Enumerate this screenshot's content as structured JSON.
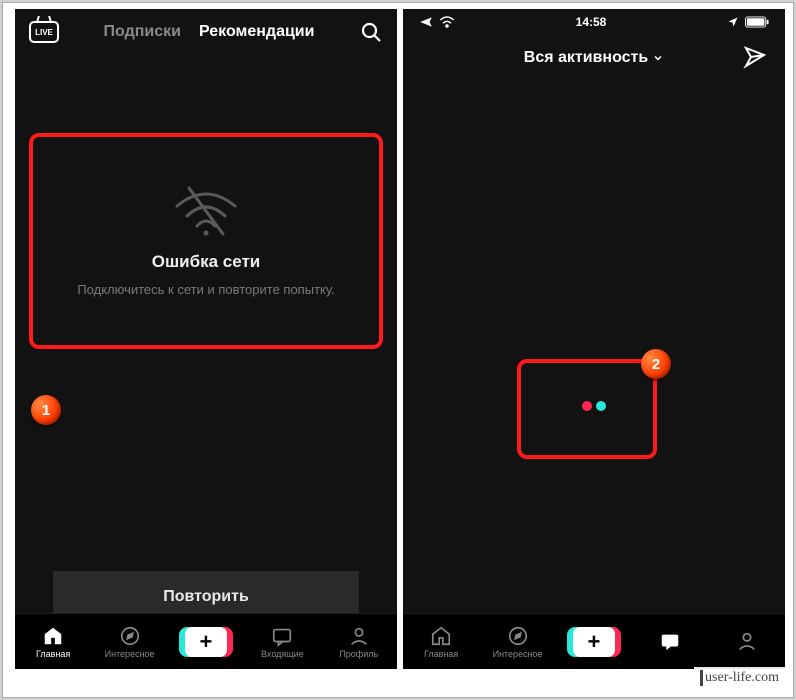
{
  "left": {
    "tabs": {
      "following": "Подписки",
      "foryou": "Рекомендации"
    },
    "error_title": "Ошибка сети",
    "error_sub": "Подключитесь к сети и повторите попытку.",
    "retry_label": "Повторить",
    "live_label": "LIVE",
    "nav": {
      "home": "Главная",
      "interesting": "Интересное",
      "inbox": "Входящие",
      "profile": "Профиль"
    },
    "marker": "1"
  },
  "right": {
    "status_time": "14:58",
    "activity_title": "Вся активность",
    "nav": {
      "home": "Главная",
      "interesting": "Интересное",
      "inbox": "",
      "profile": ""
    },
    "marker": "2"
  },
  "watermark": "user-life.com",
  "icons": {
    "search": "search-icon",
    "wifi_off": "wifi-off-icon",
    "airplane": "airplane-icon",
    "wifi": "wifi-icon",
    "location": "location-arrow-icon",
    "battery": "battery-icon",
    "send": "paper-plane-icon",
    "chevron_down": "chevron-down-icon",
    "home": "home-icon",
    "compass": "compass-icon",
    "inbox": "message-icon",
    "profile": "person-icon"
  },
  "colors": {
    "accent_red": "#ff2754",
    "accent_cyan": "#28e8d9",
    "callout_red": "#ff1a1a"
  }
}
